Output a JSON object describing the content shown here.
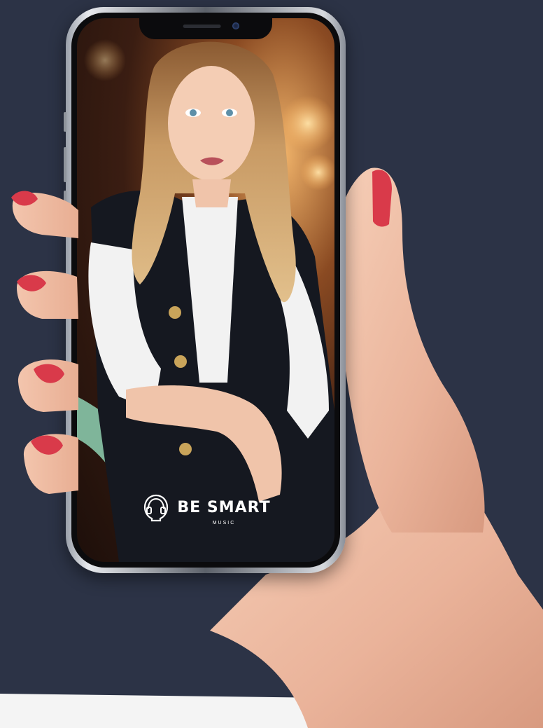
{
  "scene": {
    "background_color": "#2c3346",
    "nail_color": "#d93a4a",
    "skin_color": "#f2c2a8"
  },
  "brand": {
    "name": "BE SMART",
    "subtitle": "MUSIC",
    "logo_icon": "headphones-head-icon"
  }
}
